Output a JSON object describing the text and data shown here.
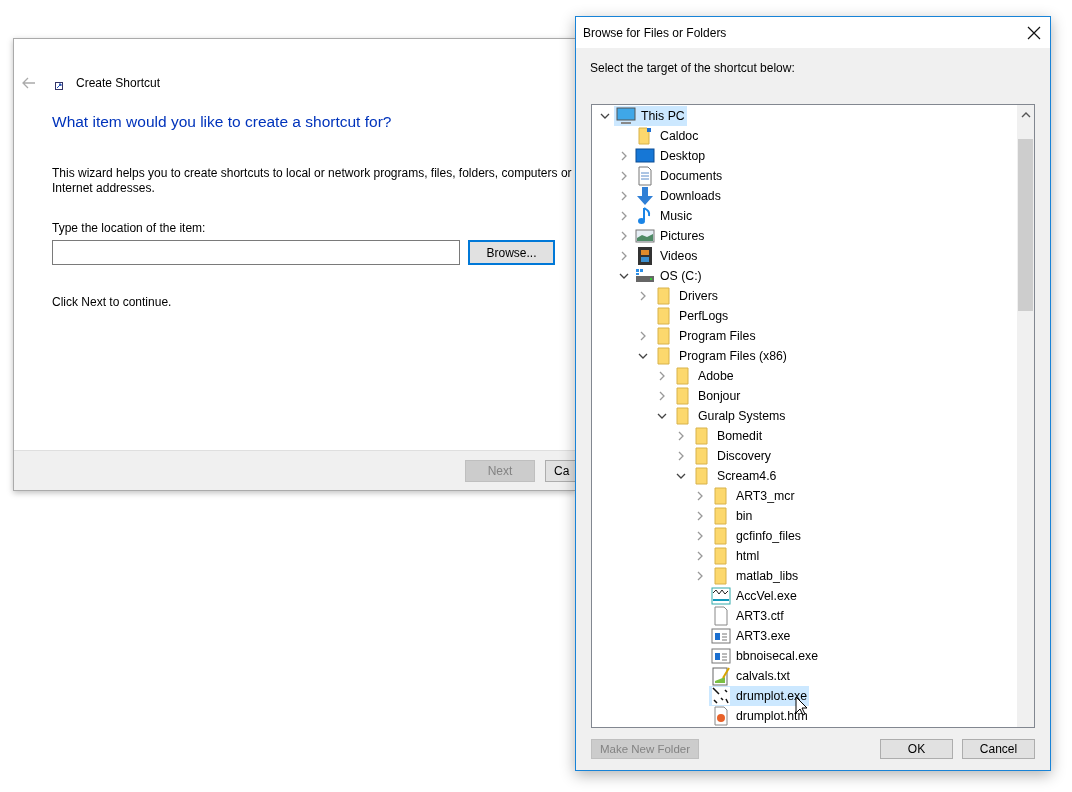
{
  "wizard": {
    "title": "Create Shortcut",
    "heading": "What item would you like to create a shortcut for?",
    "description": "This wizard helps you to create shortcuts to local or network programs, files, folders, computers or Internet addresses.",
    "location_label": "Type the location of the item:",
    "browse_button": {
      "label": "Browse...",
      "focused": true
    },
    "hint": "Click Next to continue.",
    "footer_buttons": [
      {
        "label": "Next",
        "disabled": true
      },
      {
        "label": "Ca",
        "disabled": false
      }
    ]
  },
  "browse_dialog": {
    "title": "Browse for Files or Folders",
    "instruction": "Select the target of the shortcut below:",
    "tree": [
      {
        "label": "This PC",
        "kind": "pc",
        "expanded": true,
        "selected": true,
        "children": [
          {
            "label": "Caldoc",
            "kind": "folder-link",
            "selected": false
          },
          {
            "label": "Desktop",
            "kind": "desktop",
            "expanded": false,
            "selected": false
          },
          {
            "label": "Documents",
            "kind": "documents",
            "expanded": false,
            "selected": false
          },
          {
            "label": "Downloads",
            "kind": "downloads",
            "expanded": false,
            "selected": false
          },
          {
            "label": "Music",
            "kind": "music",
            "expanded": false,
            "selected": false
          },
          {
            "label": "Pictures",
            "kind": "pictures",
            "expanded": false,
            "selected": false
          },
          {
            "label": "Videos",
            "kind": "videos",
            "expanded": false,
            "selected": false
          },
          {
            "label": "OS (C:)",
            "kind": "drive",
            "expanded": true,
            "selected": false,
            "children": [
              {
                "label": "Drivers",
                "kind": "folder",
                "expanded": false,
                "selected": false
              },
              {
                "label": "PerfLogs",
                "kind": "folder",
                "selected": false
              },
              {
                "label": "Program Files",
                "kind": "folder",
                "expanded": false,
                "selected": false
              },
              {
                "label": "Program Files (x86)",
                "kind": "folder",
                "expanded": true,
                "selected": false,
                "children": [
                  {
                    "label": "Adobe",
                    "kind": "folder",
                    "expanded": false,
                    "selected": false
                  },
                  {
                    "label": "Bonjour",
                    "kind": "folder",
                    "expanded": false,
                    "selected": false
                  },
                  {
                    "label": "Guralp Systems",
                    "kind": "folder",
                    "expanded": true,
                    "selected": false,
                    "children": [
                      {
                        "label": "Bomedit",
                        "kind": "folder",
                        "expanded": false,
                        "selected": false
                      },
                      {
                        "label": "Discovery",
                        "kind": "folder",
                        "expanded": false,
                        "selected": false
                      },
                      {
                        "label": "Scream4.6",
                        "kind": "folder",
                        "expanded": true,
                        "selected": false,
                        "children": [
                          {
                            "label": "ART3_mcr",
                            "kind": "folder",
                            "expanded": false,
                            "selected": false
                          },
                          {
                            "label": "bin",
                            "kind": "folder",
                            "expanded": false,
                            "selected": false
                          },
                          {
                            "label": "gcfinfo_files",
                            "kind": "folder",
                            "expanded": false,
                            "selected": false
                          },
                          {
                            "label": "html",
                            "kind": "folder",
                            "expanded": false,
                            "selected": false
                          },
                          {
                            "label": "matlab_libs",
                            "kind": "folder",
                            "expanded": false,
                            "selected": false
                          },
                          {
                            "label": "AccVel.exe",
                            "kind": "chart-app",
                            "selected": false
                          },
                          {
                            "label": "ART3.ctf",
                            "kind": "file",
                            "selected": false
                          },
                          {
                            "label": "ART3.exe",
                            "kind": "program",
                            "selected": false
                          },
                          {
                            "label": "bbnoisecal.exe",
                            "kind": "program",
                            "selected": false
                          },
                          {
                            "label": "calvals.txt",
                            "kind": "text-file",
                            "selected": false
                          },
                          {
                            "label": "drumplot.exe",
                            "kind": "plot-app",
                            "selected": true
                          },
                          {
                            "label": "drumplot.htm",
                            "kind": "web-file",
                            "selected": false
                          }
                        ]
                      }
                    ]
                  }
                ]
              }
            ]
          }
        ]
      }
    ],
    "buttons": [
      {
        "label": "Make New Folder",
        "disabled": true
      },
      {
        "label": "OK",
        "disabled": false
      },
      {
        "label": "Cancel",
        "disabled": false
      }
    ]
  }
}
